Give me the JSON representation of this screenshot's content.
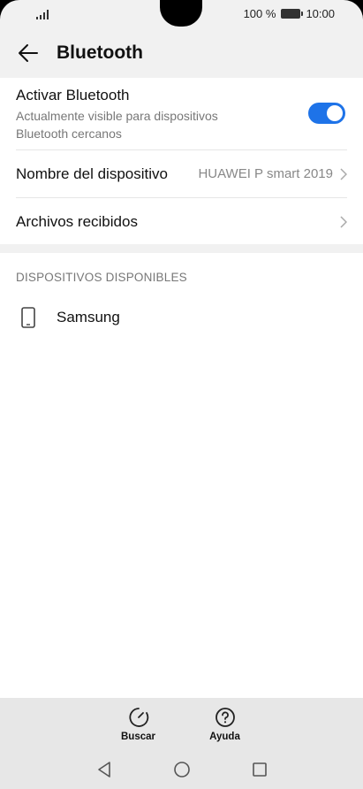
{
  "status_bar": {
    "battery_text": "100 %",
    "time": "10:00",
    "icons": [
      "signal-icon",
      "battery-icon"
    ]
  },
  "header": {
    "title": "Bluetooth",
    "back_icon": "arrow-left-icon"
  },
  "settings": {
    "toggle": {
      "label": "Activar Bluetooth",
      "sublabel": "Actualmente visible para dispositivos Bluetooth cercanos",
      "enabled": true
    },
    "device_name": {
      "label": "Nombre del dispositivo",
      "value": "HUAWEI P smart 2019"
    },
    "received_files": {
      "label": "Archivos recibidos"
    }
  },
  "available": {
    "header": "DISPOSITIVOS DISPONIBLES",
    "devices": [
      {
        "name": "Samsung",
        "icon": "phone-icon"
      }
    ]
  },
  "actions": {
    "search_label": "Buscar",
    "help_label": "Ayuda"
  },
  "nav": {
    "icons": [
      "back-triangle-icon",
      "home-circle-icon",
      "recents-square-icon"
    ]
  },
  "colors": {
    "accent": "#1e73e8",
    "background": "#f1f1f1",
    "bar": "#e7e7e7"
  }
}
